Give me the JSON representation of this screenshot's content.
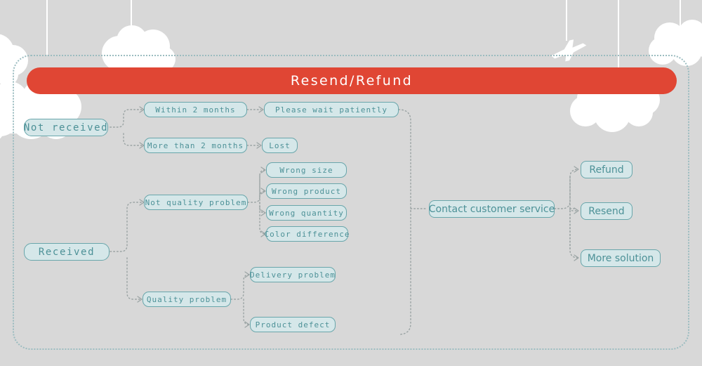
{
  "page": {
    "background_color": "#d8d8d8",
    "frame_border_color": "#9bbcc0"
  },
  "banner": {
    "title": "Resend/Refund",
    "background_color": "#e04634",
    "text_color": "#ffffff"
  },
  "node_style": {
    "fill_color": "#d5e7e9",
    "border_color": "#69a6ab",
    "text_color": "#4d9197"
  },
  "decorations": [
    {
      "name": "cloud-top-left-edge",
      "type": "cloud"
    },
    {
      "name": "cloud-top-center",
      "type": "cloud"
    },
    {
      "name": "cloud-behind-not-received",
      "type": "cloud"
    },
    {
      "name": "cloud-right-under-banner",
      "type": "cloud"
    },
    {
      "name": "cloud-top-right-corner",
      "type": "cloud"
    },
    {
      "name": "airplane-hanging",
      "type": "airplane"
    }
  ],
  "flow": {
    "roots": [
      {
        "id": "not-received",
        "label": "Not received"
      },
      {
        "id": "received",
        "label": "Received"
      }
    ],
    "level1": [
      {
        "id": "within-2-months",
        "label": "Within 2 months"
      },
      {
        "id": "more-than-2-months",
        "label": "More than 2 months"
      },
      {
        "id": "not-quality-problem",
        "label": "Not quality problem"
      },
      {
        "id": "quality-problem",
        "label": "Quality problem"
      }
    ],
    "level2": [
      {
        "id": "please-wait-patiently",
        "label": "Please wait patiently"
      },
      {
        "id": "lost",
        "label": "Lost"
      },
      {
        "id": "wrong-size",
        "label": "Wrong size"
      },
      {
        "id": "wrong-product",
        "label": "Wrong product"
      },
      {
        "id": "wrong-quantity",
        "label": "Wrong quantity"
      },
      {
        "id": "color-difference",
        "label": "Color difference"
      },
      {
        "id": "delivery-problem",
        "label": "Delivery problem"
      },
      {
        "id": "product-defect",
        "label": "Product defect"
      }
    ],
    "hub": {
      "id": "contact-customer-service",
      "label": "Contact customer service"
    },
    "outcomes": [
      {
        "id": "refund",
        "label": "Refund"
      },
      {
        "id": "resend",
        "label": "Resend"
      },
      {
        "id": "more-solution",
        "label": "More solution"
      }
    ]
  }
}
